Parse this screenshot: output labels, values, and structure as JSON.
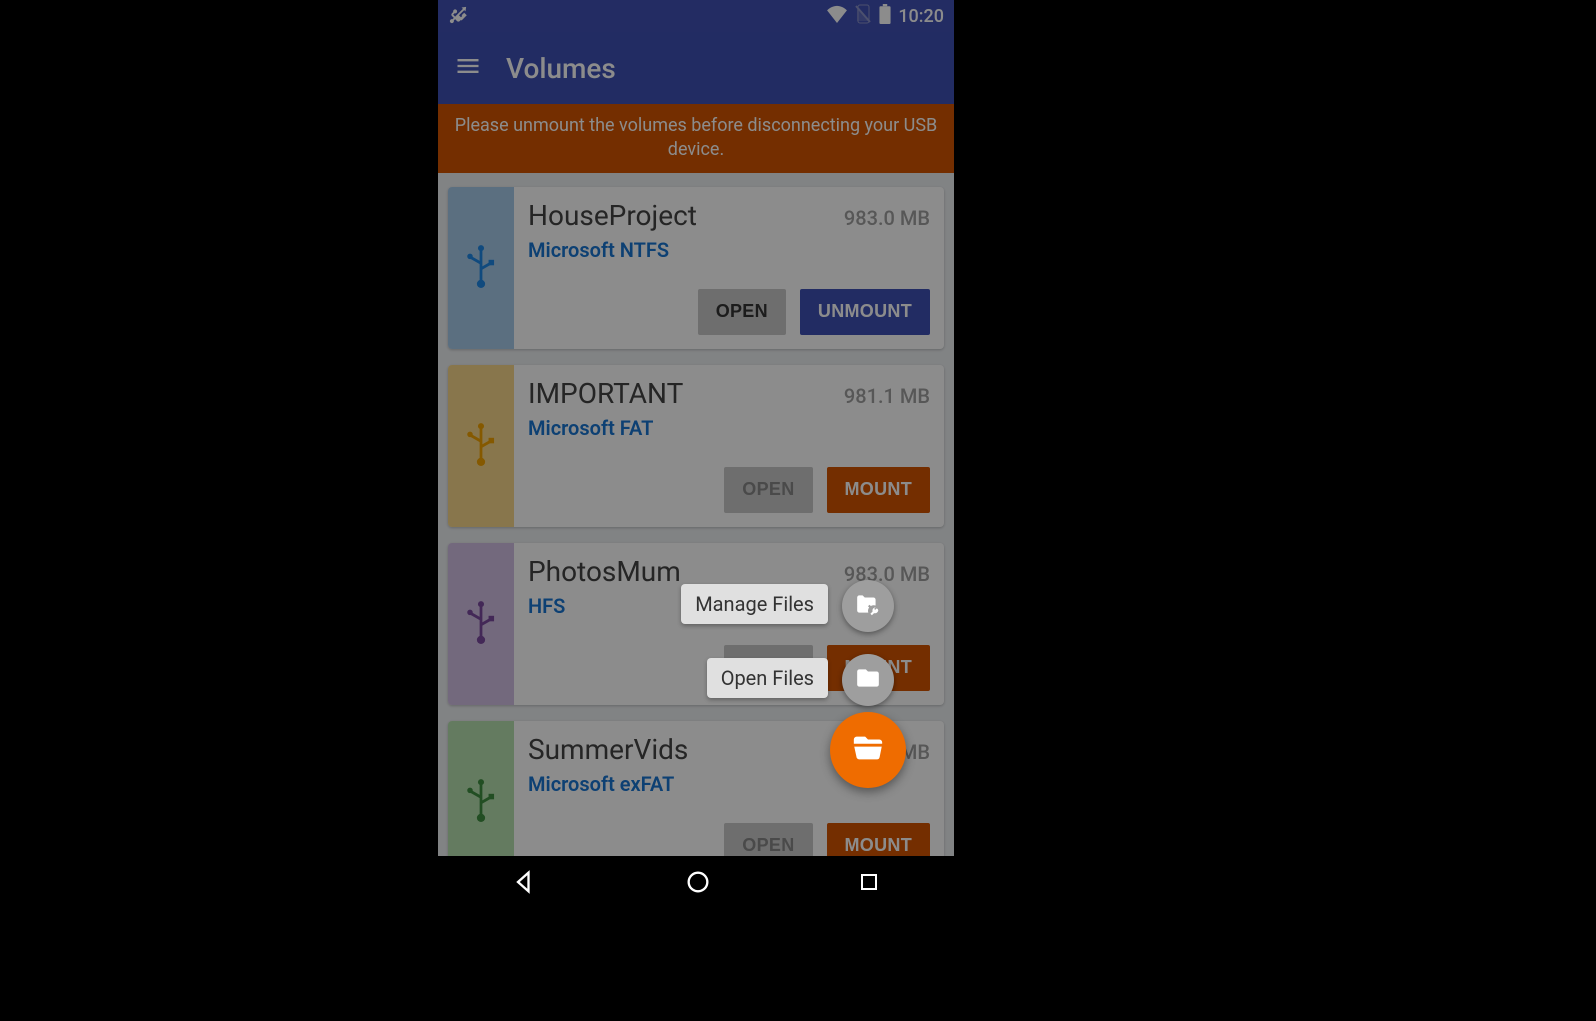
{
  "statusbar": {
    "time": "10:20"
  },
  "appbar": {
    "title": "Volumes"
  },
  "banner": {
    "text": "Please unmount the volumes before disconnecting your USB device."
  },
  "volumes": [
    {
      "name": "HouseProject",
      "size": "983.0 MB",
      "fs": "Microsoft NTFS",
      "stripe_bg": "#a7caea",
      "stripe_icon": "#1e88e5",
      "primary_label": "UNMOUNT",
      "primary_kind": "unmount",
      "open_label": "OPEN",
      "open_enabled": true
    },
    {
      "name": "IMPORTANT",
      "size": "981.1 MB",
      "fs": "Microsoft FAT",
      "stripe_bg": "#f8d88a",
      "stripe_icon": "#f2a300",
      "primary_label": "MOUNT",
      "primary_kind": "mount",
      "open_label": "OPEN",
      "open_enabled": false
    },
    {
      "name": "PhotosMum",
      "size": "983.0 MB",
      "fs": "HFS",
      "stripe_bg": "#d1bfe3",
      "stripe_icon": "#7b4a9e",
      "primary_label": "MOUNT",
      "primary_kind": "mount",
      "open_label": "OPEN",
      "open_enabled": false
    },
    {
      "name": "SummerVids",
      "size": "983.0 MB",
      "fs": "Microsoft exFAT",
      "stripe_bg": "#b7e0b0",
      "stripe_icon": "#3e8e41",
      "primary_label": "MOUNT",
      "primary_kind": "mount",
      "open_label": "OPEN",
      "open_enabled": false
    }
  ],
  "fab": {
    "actions": [
      {
        "label": "Manage Files",
        "icon": "folder-wrench-icon"
      },
      {
        "label": "Open Files",
        "icon": "folder-icon"
      }
    ]
  }
}
